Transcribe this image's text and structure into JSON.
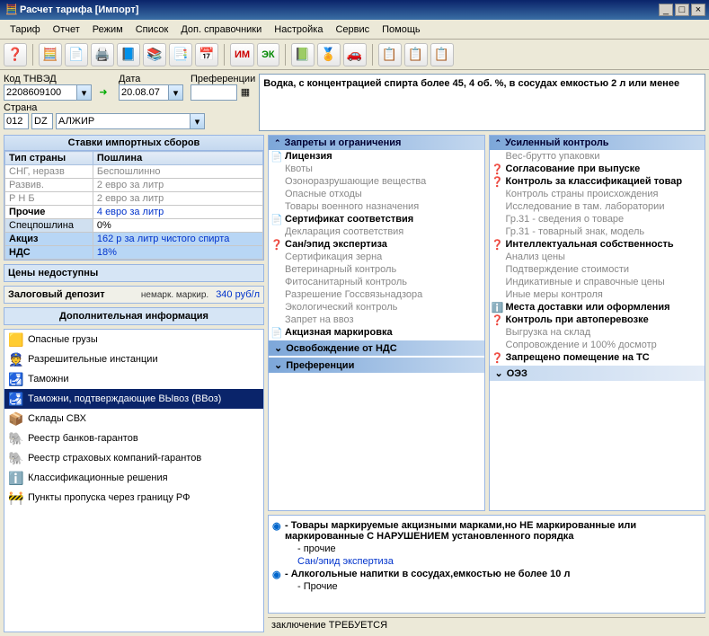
{
  "window": {
    "title": "Расчет тарифа [Импорт]"
  },
  "menu": [
    "Тариф",
    "Отчет",
    "Режим",
    "Список",
    "Доп. справочники",
    "Настройка",
    "Сервис",
    "Помощь"
  ],
  "toolbar": {
    "im": "ИМ",
    "ek": "ЭК"
  },
  "form": {
    "code_label": "Код ТНВЭД",
    "code": "2208609100",
    "date_label": "Дата",
    "date": "20.08.07",
    "pref_label": "Преференции",
    "country_label": "Страна",
    "country_code1": "012",
    "country_code2": "DZ",
    "country_name": "АЛЖИР"
  },
  "description": "Водка, с концентрацией спирта более 45, 4 об. %, в сосудах емкостью 2 л или менее",
  "rates": {
    "title": "Ставки импортных сборов",
    "col1": "Тип страны",
    "col2": "Пошлина",
    "rows": [
      {
        "t": "СНГ, неразв",
        "v": "Беспошлинно",
        "g": true
      },
      {
        "t": "Развив.",
        "v": "2 евро за литр",
        "g": true
      },
      {
        "t": "Р Н Б",
        "v": "2 евро за литр",
        "g": true
      },
      {
        "t": "Прочие",
        "v": "4 евро за литр",
        "b": true
      }
    ],
    "spec_label": "Спецпошлина",
    "spec": "0%",
    "akc_label": "Акциз",
    "akc": "162 р за литр чистого спирта",
    "nds_label": "НДС",
    "nds": "18%"
  },
  "prices_na": "Цены недоступны",
  "deposit": {
    "label": "Залоговый депозит",
    "sub": "немарк. маркир.",
    "val": "340 руб/л"
  },
  "extra_title": "Дополнительная информация",
  "extra": [
    {
      "i": "🟨",
      "t": "Опасные грузы"
    },
    {
      "i": "👮",
      "t": "Разрешительные инстанции"
    },
    {
      "i": "🛃",
      "t": "Таможни"
    },
    {
      "i": "🛃",
      "t": "Таможни, подтверждающие ВЫвоз (ВВоз)",
      "sel": true
    },
    {
      "i": "📦",
      "t": "Склады СВХ"
    },
    {
      "i": "🐘",
      "t": "Реестр банков-гарантов"
    },
    {
      "i": "🐘",
      "t": "Реестр страховых компаний-гарантов"
    },
    {
      "i": "ℹ️",
      "t": "Классификационные решения"
    },
    {
      "i": "🚧",
      "t": "Пункты пропуска через границу РФ"
    }
  ],
  "colA": {
    "hdr": "Запреты и ограничения",
    "items": [
      {
        "t": "Лицензия",
        "b": true,
        "ic": "📄"
      },
      {
        "t": "Квоты",
        "g": true
      },
      {
        "t": "Озоноразрушающие вещества",
        "g": true
      },
      {
        "t": "Опасные отходы",
        "g": true
      },
      {
        "t": "Товары военного назначения",
        "g": true
      },
      {
        "t": "Сертификат соответствия",
        "b": true,
        "ic": "📄"
      },
      {
        "t": "Декларация соответствия",
        "g": true
      },
      {
        "t": "Сан/эпид экспертиза",
        "b": true,
        "ic": "❓"
      },
      {
        "t": "Сертификация зерна",
        "g": true
      },
      {
        "t": "Ветеринарный контроль",
        "g": true
      },
      {
        "t": "Фитосанитарный контроль",
        "g": true
      },
      {
        "t": "Разрешение Госсвязьнадзора",
        "g": true
      },
      {
        "t": "Экологический контроль",
        "g": true
      },
      {
        "t": "Запрет на ввоз",
        "g": true
      },
      {
        "t": "Акцизная маркировка",
        "b": true,
        "ic": "📄"
      }
    ],
    "sub1": "Освобождение от НДС",
    "sub2": "Преференции"
  },
  "colB": {
    "hdr": "Усиленный контроль",
    "items": [
      {
        "t": "Вес-брутто упаковки",
        "g": true
      },
      {
        "t": "Согласование при выпуске",
        "b": true,
        "ic": "❓"
      },
      {
        "t": "Контроль за классификацией товар",
        "b": true,
        "ic": "❓"
      },
      {
        "t": "Контроль страны происхождения",
        "g": true
      },
      {
        "t": "Исследование в там. лаборатории",
        "g": true
      },
      {
        "t": "Гр.31 - сведения о товаре",
        "g": true
      },
      {
        "t": "Гр.31 - товарный знак, модель",
        "g": true
      },
      {
        "t": "Интеллектуальная собственность",
        "b": true,
        "ic": "❓"
      },
      {
        "t": "Анализ цены",
        "g": true
      },
      {
        "t": "Подтверждение стоимости",
        "g": true
      },
      {
        "t": "Индикативные и справочные цены",
        "g": true
      },
      {
        "t": "Иные меры контроля",
        "g": true
      },
      {
        "t": "Места доставки или оформления",
        "b": true,
        "ic": "ℹ️"
      },
      {
        "t": "Контроль при автоперевозке",
        "b": true,
        "ic": "❓"
      },
      {
        "t": "Выгрузка на склад",
        "g": true
      },
      {
        "t": "Сопровождение и 100% досмотр",
        "g": true
      },
      {
        "t": "Запрещено помещение на ТС",
        "b": true,
        "ic": "❓"
      }
    ],
    "sub": "ОЭЗ"
  },
  "bottom": {
    "lines": [
      {
        "t": "- Товары маркируемые акцизными марками,но НЕ маркированные или маркированные С НАРУШЕНИЕМ установленного порядка",
        "b": true,
        "dot": "◉"
      },
      {
        "t": "- прочие",
        "sub": true
      },
      {
        "t": "Сан/эпид экспертиза",
        "sub": true,
        "blue": true
      },
      {
        "t": "- Алкогольные напитки в сосудах,емкостью не более 10 л",
        "b": true,
        "dot": "◉"
      },
      {
        "t": "- Прочие",
        "sub": true
      }
    ]
  },
  "status": "заключение ТРЕБУЕТСЯ"
}
